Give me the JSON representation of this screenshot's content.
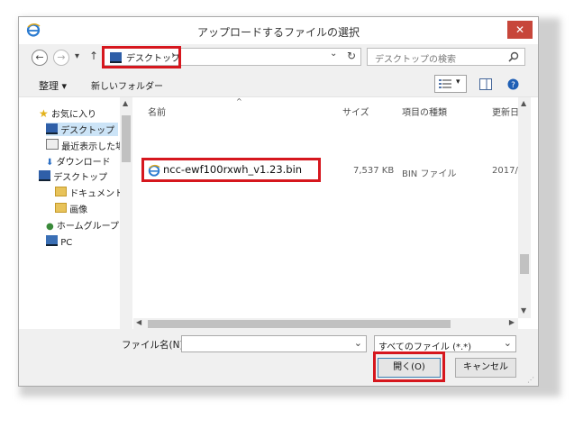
{
  "window": {
    "title": "アップロードするファイルの選択",
    "close_glyph": "✕"
  },
  "nav": {
    "back_glyph": "←",
    "forward_glyph": "→",
    "dropdown_glyph": "▾",
    "up_glyph": "↑",
    "refresh_glyph": "↻"
  },
  "address": {
    "location": "デスクトップ",
    "chevron": "›",
    "dropdown_glyph": "⌄"
  },
  "search": {
    "placeholder": "デスクトップの検索",
    "icon": "search-icon"
  },
  "toolbar": {
    "organize_label": "整理 ▾",
    "new_folder_label": "新しいフォルダー"
  },
  "sidebar": {
    "items": [
      {
        "label": "お気に入り",
        "icon": "star-icon"
      },
      {
        "label": "デスクトップ",
        "icon": "desktop-icon",
        "selected": true
      },
      {
        "label": "最近表示した場所",
        "icon": "recent-places-icon"
      },
      {
        "label": "ダウンロード",
        "icon": "download-icon"
      },
      {
        "label": "デスクトップ",
        "icon": "desktop-icon"
      },
      {
        "label": "ドキュメント",
        "icon": "folder-icon"
      },
      {
        "label": "画像",
        "icon": "folder-icon"
      },
      {
        "label": "ホームグループ",
        "icon": "homegroup-icon"
      },
      {
        "label": "PC",
        "icon": "pc-icon"
      }
    ]
  },
  "columns": {
    "name": "名前",
    "size": "サイズ",
    "type": "項目の種類",
    "date": "更新日"
  },
  "files": [
    {
      "name": "ncc-ewf100rxwh_v1.23.bin",
      "size": "7,537 KB",
      "type": "BIN ファイル",
      "date": "2017/"
    }
  ],
  "footer": {
    "filename_label": "ファイル名(N):",
    "filename_value": "",
    "filetype_value": "すべてのファイル (*.*)",
    "open_label": "開く(O)",
    "cancel_label": "キャンセル"
  },
  "colors": {
    "highlight": "#d6171e",
    "selection": "#cce4f7"
  }
}
